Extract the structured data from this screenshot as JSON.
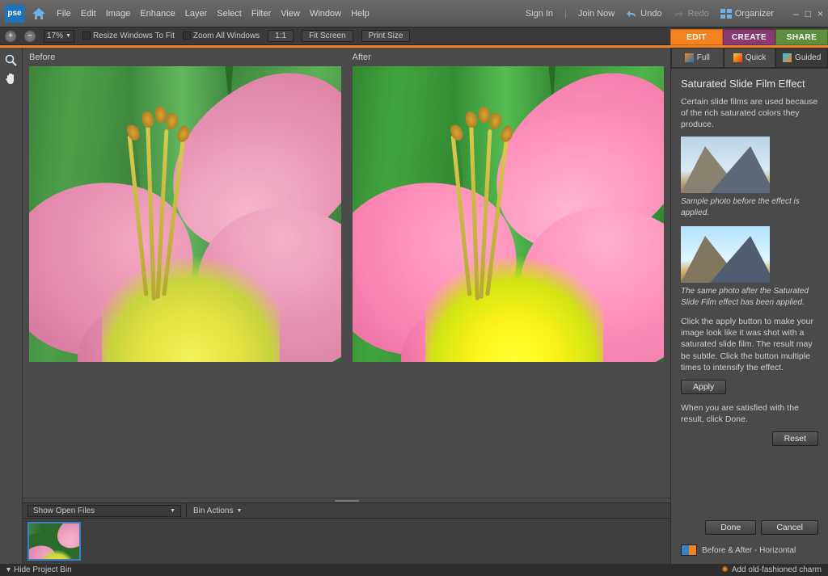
{
  "app": {
    "logo": "pse"
  },
  "menu": [
    "File",
    "Edit",
    "Image",
    "Enhance",
    "Layer",
    "Select",
    "Filter",
    "View",
    "Window",
    "Help"
  ],
  "titlebar_right": {
    "sign_in": "Sign In",
    "join_now": "Join Now",
    "undo": "Undo",
    "redo": "Redo",
    "organizer": "Organizer"
  },
  "options": {
    "zoom_value": "17%",
    "resize_windows": "Resize Windows To Fit",
    "zoom_all": "Zoom All Windows",
    "one_to_one": "1:1",
    "fit_screen": "Fit Screen",
    "print_size": "Print Size"
  },
  "modetabs": {
    "edit": "EDIT",
    "create": "CREATE",
    "share": "SHARE"
  },
  "workspace": {
    "before_label": "Before",
    "after_label": "After"
  },
  "bin": {
    "selector": "Show Open Files",
    "actions_label": "Bin Actions"
  },
  "tabs3": {
    "full": "Full",
    "quick": "Quick",
    "guided": "Guided"
  },
  "guide": {
    "title": "Saturated Slide Film Effect",
    "intro": "Certain slide films are used because of the rich saturated colors they produce.",
    "caption_before": "Sample photo before the effect is applied.",
    "caption_after": "The same photo after the Saturated Slide Film effect has been applied.",
    "instructions": "Click the apply button to make your image look like it was shot with a saturated slide film. The result may be subtle. Click the button multiple times to intensify the effect.",
    "apply": "Apply",
    "satisfied": "When you are satisfied with the result, click Done.",
    "reset": "Reset",
    "done": "Done",
    "cancel": "Cancel",
    "viewmode": "Before & After - Horizontal"
  },
  "status": {
    "hide_bin": "Hide Project Bin",
    "tip": "Add old-fashioned charm"
  }
}
